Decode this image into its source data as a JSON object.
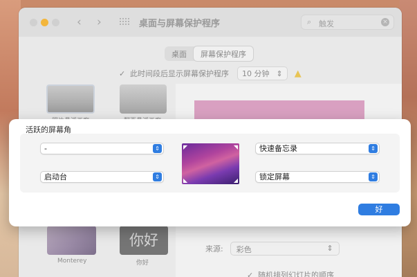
{
  "window": {
    "title": "桌面与屏幕保护程序",
    "search_placeholder": "触发",
    "nav": {
      "back_icon": "‹",
      "forward_icon": "›"
    }
  },
  "tabs": [
    {
      "label": "桌面",
      "active": false
    },
    {
      "label": "屏幕保护程序",
      "active": true
    }
  ],
  "idle_option": {
    "label": "此时间段后显示屏幕保护程序",
    "checked": true,
    "time_value": "10 分钟",
    "warning_icon": "warning-icon"
  },
  "savers": [
    {
      "label": "照片悬浮画廊"
    },
    {
      "label": "翻页悬浮画廊"
    },
    {
      "label": "Monterey"
    },
    {
      "label": "你好"
    }
  ],
  "hello_glyph": "你好",
  "options": {
    "source_label": "来源:",
    "source_value": "彩色",
    "shuffle_label": "随机排列幻灯片的顺序"
  },
  "sheet": {
    "title": "活跃的屏幕角",
    "top_left": "-",
    "bottom_left": "启动台",
    "top_right": "快速备忘录",
    "bottom_right": "锁定屏幕",
    "ok_label": "好",
    "accent": "#2f7de1"
  }
}
